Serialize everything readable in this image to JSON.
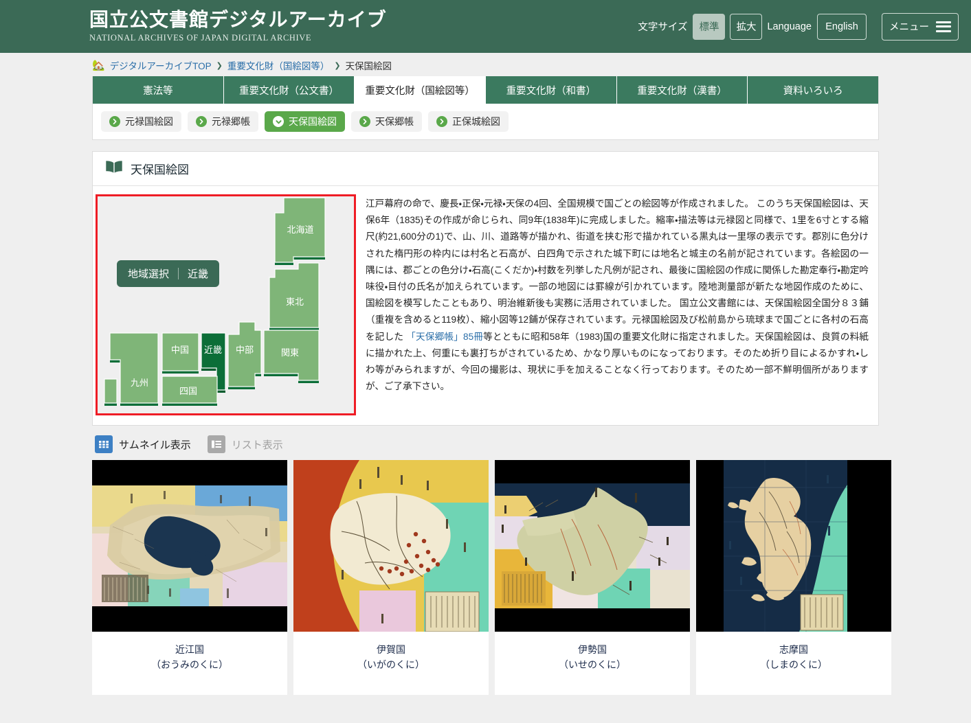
{
  "header": {
    "logo_ja": "国立公文書館デジタルアーカイブ",
    "logo_en": "NATIONAL ARCHIVES OF JAPAN  DIGITAL ARCHIVE",
    "text_size_label": "文字サイズ",
    "size_normal": "標準",
    "size_large": "拡大",
    "language_label": "Language",
    "language_value": "English",
    "menu_label": "メニュー"
  },
  "breadcrumb": {
    "home_icon": "home-icon",
    "items": [
      {
        "label": "デジタルアーカイブTOP",
        "type": "link"
      },
      {
        "label": "重要文化財（国絵図等）",
        "type": "link"
      },
      {
        "label": "天保国絵図",
        "type": "current"
      }
    ],
    "separator": "❯"
  },
  "tabs": [
    {
      "label": "憲法等",
      "active": false
    },
    {
      "label": "重要文化財（公文書）",
      "active": false
    },
    {
      "label": "重要文化財（国絵図等）",
      "active": true
    },
    {
      "label": "重要文化財（和書）",
      "active": false
    },
    {
      "label": "重要文化財（漢書）",
      "active": false
    },
    {
      "label": "資料いろいろ",
      "active": false
    }
  ],
  "subtabs": [
    {
      "label": "元禄国絵図",
      "active": false
    },
    {
      "label": "元禄郷帳",
      "active": false
    },
    {
      "label": "天保国絵図",
      "active": true
    },
    {
      "label": "天保郷帳",
      "active": false
    },
    {
      "label": "正保城絵図",
      "active": false
    }
  ],
  "section": {
    "icon": "open-book-icon",
    "title": "天保国絵図"
  },
  "map": {
    "selector_label": "地域選択",
    "selected_region": "近畿",
    "highlight_color": "#ef1c25",
    "region_fill": "#7fb578",
    "region_fill_selected": "#0c6e38",
    "region_edge": "#0c6e38",
    "regions": [
      {
        "name": "北海道",
        "selected": false
      },
      {
        "name": "東北",
        "selected": false
      },
      {
        "name": "関東",
        "selected": false
      },
      {
        "name": "中部",
        "selected": false
      },
      {
        "name": "近畿",
        "selected": true
      },
      {
        "name": "中国",
        "selected": false
      },
      {
        "name": "四国",
        "selected": false
      },
      {
        "name": "九州",
        "selected": false
      }
    ]
  },
  "description": {
    "part1": "江戸幕府の命で、慶長・正保・元禄・天保の4回、全国規模で国ごとの絵図等が作成されました。 このうち天保国絵図は、天保6年（1835)その作成が命じられ、同9年(1838年)に完成しました。縮率・描法等は元禄図と同様で、1里を6寸とする縮尺(約21,600分の1)で、山、川、道路等が描かれ、街道を挟む形で描かれている黒丸は一里塚の表示です。郡別に色分けされた楕円形の枠内には村名と石高が、白四角で示された城下町には地名と城主の名前が記されています。各絵図の一隅には、郡ごとの色分け・石高(こくだか)・村数を列挙した凡例が記され、最後に国絵図の作成に関係した勘定奉行・勘定吟味役・目付の氏名が加えられています。一部の地図には罫線が引かれています。陸地測量部が新たな地図作成のために、国絵図を模写したこともあり、明治維新後も実務に活用されていました。 国立公文書館には、天保国絵図全国分８３鋪（重複を含めると119枚）、縮小図等12鋪が保存されています。元禄国絵図及び松前島から琉球まで国ごとに各村の石高を記した ",
    "link_text": "「天保郷帳」85冊",
    "part2": "等とともに昭和58年（1983)国の重要文化財に指定されました。天保国絵図は、良質の料紙に描かれた上、何重にも裏打ちがされているため、かなり厚いものになっております。そのため折り目によるかすれ・しわ等がみられますが、今回の撮影は、現状に手を加えることなく行っております。そのため一部不鮮明個所がありますが、ご了承下さい。"
  },
  "view_toggle": {
    "thumbnail_label": "サムネイル表示",
    "thumbnail_icon": "grid-icon",
    "thumbnail_active": true,
    "list_label": "リスト表示",
    "list_icon": "list-icon",
    "list_active": false,
    "active_color": "#3d80c4",
    "inactive_color": "#a9a9a9"
  },
  "cards": [
    {
      "title": "近江国",
      "reading": "（おうみのくに）",
      "thumb": "omi-map-thumbnail",
      "orientation": "landscape"
    },
    {
      "title": "伊賀国",
      "reading": "（いがのくに）",
      "thumb": "iga-map-thumbnail",
      "orientation": "full"
    },
    {
      "title": "伊勢国",
      "reading": "（いせのくに）",
      "thumb": "ise-map-thumbnail",
      "orientation": "landscape"
    },
    {
      "title": "志摩国",
      "reading": "（しまのくに）",
      "thumb": "shima-map-thumbnail",
      "orientation": "portrait"
    }
  ]
}
